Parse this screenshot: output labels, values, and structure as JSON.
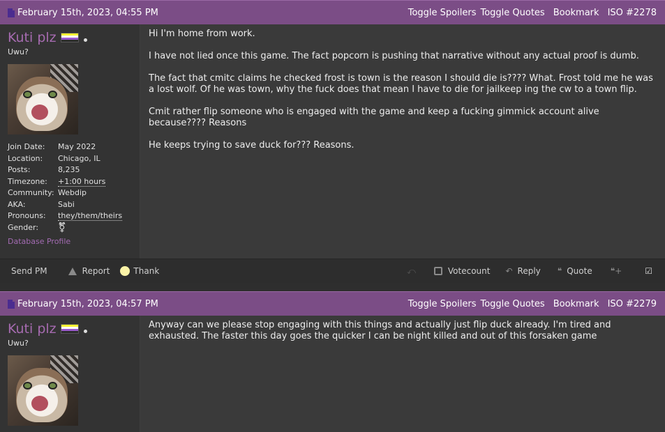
{
  "header": {
    "toggle_spoilers": "Toggle Spoilers",
    "toggle_quotes": "Toggle Quotes",
    "bookmark": "Bookmark",
    "iso_prefix": "ISO"
  },
  "colors": {
    "header_bg": "#7b4d86",
    "username": "#a66bb0",
    "link": "#a36bb2",
    "message_bg": "#3a3a3a",
    "userinfo_bg": "#333333",
    "footer_bg": "#2d2d2d"
  },
  "posts": [
    {
      "date": "February 15th, 2023, 04:55 PM",
      "iso": "ISO #2278",
      "user": {
        "name": "Kuti plz",
        "title": "Uwu?",
        "stats": [
          {
            "label": "Join Date:",
            "value": "May 2022"
          },
          {
            "label": "Location:",
            "value": "Chicago, IL"
          },
          {
            "label": "Posts:",
            "value": "8,235"
          },
          {
            "label": "Timezone:",
            "value": "+1:00 hours"
          },
          {
            "label": "Community:",
            "value": "Webdip"
          },
          {
            "label": "AKA:",
            "value": "Sabi"
          },
          {
            "label": "Pronouns:",
            "value": "they/them/theirs"
          },
          {
            "label": "Gender:",
            "value": "⚧"
          }
        ],
        "db_profile": "Database Profile"
      },
      "message": [
        "Hi I'm home from work.",
        "I have not lied once this game. The fact popcorn is pushing that narrative without any actual proof is dumb.",
        "The fact that cmitc claims he checked frost is town is the reason I should die is???? What. Frost told me he was a lost wolf. Of he was town, why the fuck does that mean I have to die for jailkeep ing the cw to a town flip.",
        "Cmit rather flip someone who is engaged with the game and keep a fucking gimmick account alive because???? Reasons",
        "He keeps trying to save duck for??? Reasons."
      ],
      "footer": {
        "send_pm": "Send PM",
        "report": "Report",
        "thank": "Thank",
        "votecount": "Votecount",
        "reply": "Reply",
        "quote": "Quote"
      }
    },
    {
      "date": "February 15th, 2023, 04:57 PM",
      "iso": "ISO #2279",
      "user": {
        "name": "Kuti plz",
        "title": "Uwu?"
      },
      "message": [
        "Anyway can we please stop engaging with this things and actually just flip duck already. I'm tired and exhausted. The faster this day goes the quicker I can be night killed and out of this forsaken game"
      ]
    }
  ]
}
